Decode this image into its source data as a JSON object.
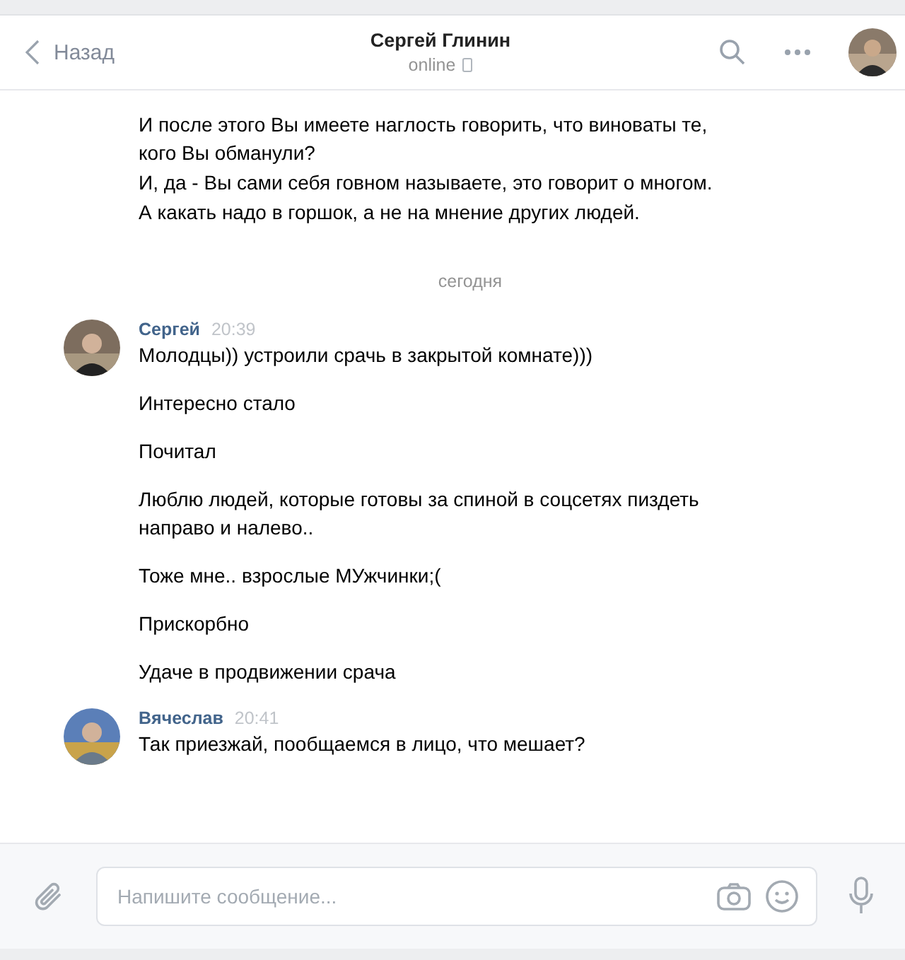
{
  "header": {
    "back": "Назад",
    "title": "Сергей Глинин",
    "status": "online"
  },
  "earlier_messages": [
    "И после этого Вы имеете наглость говорить, что виноваты те, кого Вы обманули?",
    "И, да - Вы сами себя говном называете, это говорит о многом.",
    "А какать надо в горшок, а не на мнение других людей."
  ],
  "date_divider": "сегодня",
  "groups": [
    {
      "author": "Сергей",
      "time": "20:39",
      "messages": [
        "Молодцы)) устроили срачь в закрытой комнате)))",
        "Интересно стало",
        "Почитал",
        "Люблю людей, которые готовы за спиной в соцсетях пиздеть направо и налево..",
        "Тоже мне.. взрослые МУжчинки;(",
        "Прискорбно",
        "Удаче в продвижении срача"
      ]
    },
    {
      "author": "Вячеслав",
      "time": "20:41",
      "messages": [
        "Так приезжай, пообщаемся в лицо, что мешает?"
      ]
    }
  ],
  "composer": {
    "placeholder": "Напишите сообщение..."
  }
}
